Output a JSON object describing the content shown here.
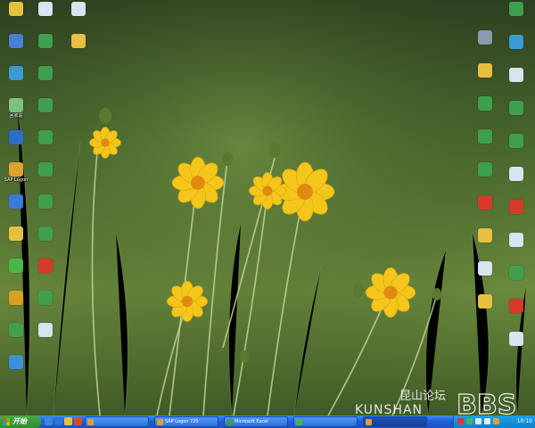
{
  "desktop": {
    "left_icons": [
      {
        "label": "",
        "icon": "folder-icon",
        "color": "#e8c040"
      },
      {
        "label": "",
        "icon": "computer-icon",
        "color": "#4a7ed8"
      },
      {
        "label": "",
        "icon": "network-icon",
        "color": "#3a9ad8"
      },
      {
        "label": "回收站",
        "icon": "recycle-bin-icon",
        "color": "#7fbf7f"
      },
      {
        "label": "",
        "icon": "kingsoft-icon",
        "color": "#2b6fc8"
      },
      {
        "label": "SAP Logon",
        "icon": "sap-logon-icon",
        "color": "#e0a030"
      },
      {
        "label": "",
        "icon": "ie-icon",
        "color": "#3a7bd8"
      },
      {
        "label": "",
        "icon": "folder-icon",
        "color": "#e8c040"
      },
      {
        "label": "",
        "icon": "360-icon",
        "color": "#49b649"
      },
      {
        "label": "",
        "icon": "app-icon",
        "color": "#d8a020"
      },
      {
        "label": "",
        "icon": "excel-file-icon",
        "color": "#3f9f4f"
      },
      {
        "label": "",
        "icon": "app-icon",
        "color": "#3f8fdf"
      }
    ],
    "second_icons": [
      {
        "label": "",
        "icon": "text-file-icon",
        "color": "#d8e4f0"
      },
      {
        "label": "",
        "icon": "excel-file-icon",
        "color": "#3f9f4f"
      },
      {
        "label": "",
        "icon": "excel-file-icon",
        "color": "#3f9f4f"
      },
      {
        "label": "",
        "icon": "excel-file-icon",
        "color": "#3f9f4f"
      },
      {
        "label": "",
        "icon": "excel-file-icon",
        "color": "#3f9f4f"
      },
      {
        "label": "",
        "icon": "excel-file-icon",
        "color": "#3f9f4f"
      },
      {
        "label": "",
        "icon": "excel-file-icon",
        "color": "#3f9f4f"
      },
      {
        "label": "",
        "icon": "excel-file-icon",
        "color": "#3f9f4f"
      },
      {
        "label": "",
        "icon": "pdf-file-icon",
        "color": "#d83a2a"
      },
      {
        "label": "",
        "icon": "excel-file-icon",
        "color": "#3f9f4f"
      },
      {
        "label": "",
        "icon": "text-file-icon",
        "color": "#d8e4f0"
      }
    ],
    "third_icons": [
      {
        "label": "",
        "icon": "text-file-icon",
        "color": "#d8e4f0"
      },
      {
        "label": "",
        "icon": "folder-icon",
        "color": "#e8c040"
      }
    ],
    "right_inner_icons": [
      {
        "label": "",
        "icon": "settings-icon",
        "color": "#8a9ab0"
      },
      {
        "label": "",
        "icon": "folder-icon",
        "color": "#e8c040"
      },
      {
        "label": "",
        "icon": "excel-file-icon",
        "color": "#3f9f4f"
      },
      {
        "label": "",
        "icon": "excel-file-icon",
        "color": "#3f9f4f"
      },
      {
        "label": "",
        "icon": "excel-file-icon",
        "color": "#3f9f4f"
      },
      {
        "label": "",
        "icon": "pdf-file-icon",
        "color": "#d83a2a"
      },
      {
        "label": "",
        "icon": "folder-icon",
        "color": "#e8c040"
      },
      {
        "label": "",
        "icon": "text-file-icon",
        "color": "#d8e4f0"
      },
      {
        "label": "",
        "icon": "folder-icon",
        "color": "#e8c040"
      }
    ],
    "right_outer_icons": [
      {
        "label": "",
        "icon": "excel-file-icon",
        "color": "#3f9f4f"
      },
      {
        "label": "",
        "icon": "network-icon",
        "color": "#3a9ad8"
      },
      {
        "label": "",
        "icon": "shortcut-icon",
        "color": "#d8e4f0"
      },
      {
        "label": "",
        "icon": "excel-file-icon",
        "color": "#3f9f4f"
      },
      {
        "label": "",
        "icon": "excel-file-icon",
        "color": "#3f9f4f"
      },
      {
        "label": "",
        "icon": "text-file-icon",
        "color": "#d8e4f0"
      },
      {
        "label": "",
        "icon": "pdf-file-icon",
        "color": "#d83a2a"
      },
      {
        "label": "",
        "icon": "shortcut-icon",
        "color": "#d8e4f0"
      },
      {
        "label": "",
        "icon": "excel-file-icon",
        "color": "#3f9f4f"
      },
      {
        "label": "",
        "icon": "pdf-file-icon",
        "color": "#d83a2a"
      },
      {
        "label": "",
        "icon": "text-file-icon",
        "color": "#d8e4f0"
      }
    ]
  },
  "taskbar": {
    "start_label": "开始",
    "quicklaunch": [
      {
        "icon": "show-desktop-icon",
        "color": "#3a8ad8"
      },
      {
        "icon": "ie-icon",
        "color": "#2f74d0"
      },
      {
        "icon": "explorer-icon",
        "color": "#e8c040"
      },
      {
        "icon": "media-icon",
        "color": "#d84a2a"
      }
    ],
    "tasks": [
      {
        "label": "",
        "icon": "app-icon",
        "color": "#e0a030",
        "active": false
      },
      {
        "label": "SAP Logon 720",
        "icon": "sap-logon-icon",
        "color": "#e0a030",
        "active": false
      },
      {
        "label": "Microsoft Excel",
        "icon": "excel-icon",
        "color": "#3f9f4f",
        "active": false
      },
      {
        "label": "",
        "icon": "app-icon",
        "color": "#49b649",
        "active": false
      },
      {
        "label": "",
        "icon": "app-icon",
        "color": "#e0a030",
        "active": true
      }
    ],
    "tray": {
      "icons": [
        {
          "icon": "input-method-icon",
          "color": "#d83a2a"
        },
        {
          "icon": "antivirus-icon",
          "color": "#49b649"
        },
        {
          "icon": "network-tray-icon",
          "color": "#e8e8e8"
        },
        {
          "icon": "volume-icon",
          "color": "#e8e8e8"
        },
        {
          "icon": "app-tray-icon",
          "color": "#e0a030"
        }
      ],
      "clock": "10:10"
    }
  },
  "watermark": {
    "cn_text": "昆山论坛",
    "en_text": "KUNSHAN",
    "bbs_text": "BBS"
  }
}
